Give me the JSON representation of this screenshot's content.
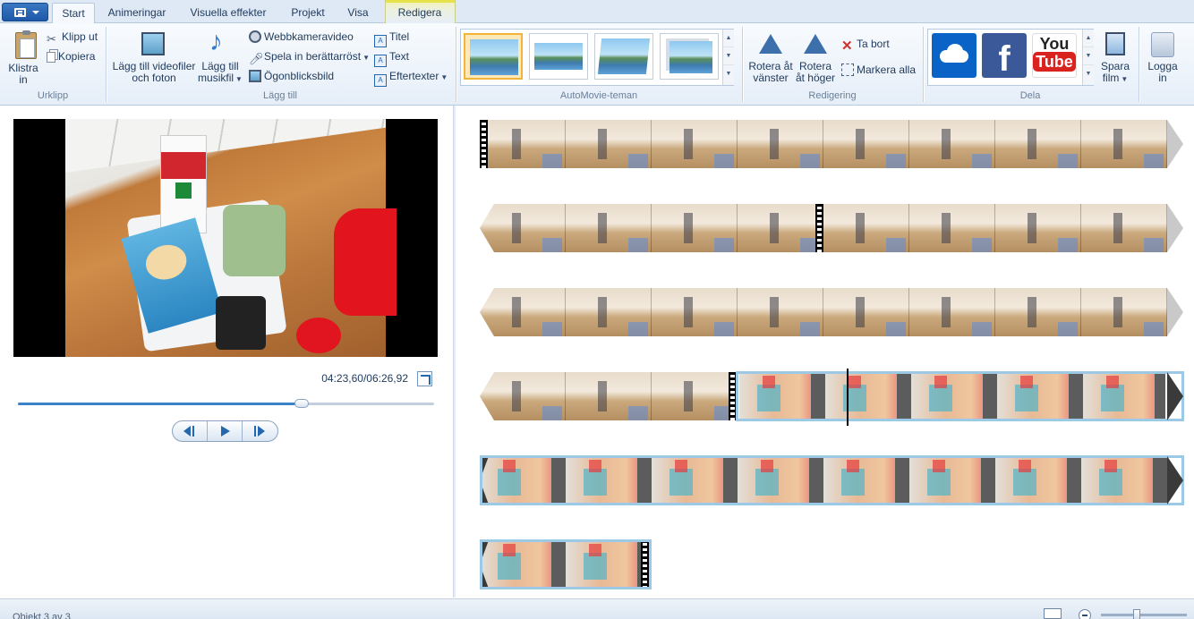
{
  "app_menu": {
    "icon": "app-menu-icon"
  },
  "tabs": [
    {
      "label": "Start",
      "active": true
    },
    {
      "label": "Animeringar"
    },
    {
      "label": "Visuella effekter"
    },
    {
      "label": "Projekt"
    },
    {
      "label": "Visa"
    },
    {
      "label": "Redigera",
      "contextual": true,
      "context_color": "#e5e24a"
    }
  ],
  "ribbon": {
    "clipboard": {
      "label": "Urklipp",
      "paste": "Klistra\nin",
      "cut": "Klipp ut",
      "copy": "Kopiera"
    },
    "add": {
      "label": "Lägg till",
      "add_videos": "Lägg till videofiler\noch foton",
      "add_music": "Lägg till\nmusikfil",
      "webcam": "Webbkameravideo",
      "narration": "Spela in berättarröst",
      "snapshot": "Ögonblicksbild",
      "title": "Titel",
      "caption": "Text",
      "credits": "Eftertexter"
    },
    "automovie": {
      "label": "AutoMovie-teman",
      "themes": [
        {
          "name": "theme-1",
          "selected": true
        },
        {
          "name": "theme-2"
        },
        {
          "name": "theme-3"
        },
        {
          "name": "theme-4"
        }
      ]
    },
    "editing": {
      "label": "Redigering",
      "rotate_left": "Rotera åt\nvänster",
      "rotate_right": "Rotera\nåt höger",
      "remove": "Ta bort",
      "select_all": "Markera alla"
    },
    "share": {
      "label": "Dela",
      "services": [
        "OneDrive",
        "Facebook",
        "YouTube"
      ],
      "save_movie": "Spara\nfilm",
      "sign_in": "Logga\nin"
    }
  },
  "player": {
    "timecode": "04:23,60/06:26,92",
    "progress_fraction": 0.6815
  },
  "storyboard": {
    "rows": [
      {
        "clips": [
          "gym"
        ]
      },
      {
        "clips": [
          "gym"
        ]
      },
      {
        "clips": [
          "gym"
        ]
      },
      {
        "clips": [
          "gym",
          "kitchen"
        ],
        "selected_from_clip": 1
      },
      {
        "clips": [
          "kitchen"
        ],
        "selected": true
      },
      {
        "clips": [
          "kitchen"
        ],
        "selected": true
      }
    ]
  },
  "status": {
    "text": "Objekt 3 av 3",
    "zoom_fraction": 0.42
  },
  "colors": {
    "accent": "#2466b0",
    "selection": "#9bc9e6",
    "theme_selected": "#f2b43b"
  }
}
